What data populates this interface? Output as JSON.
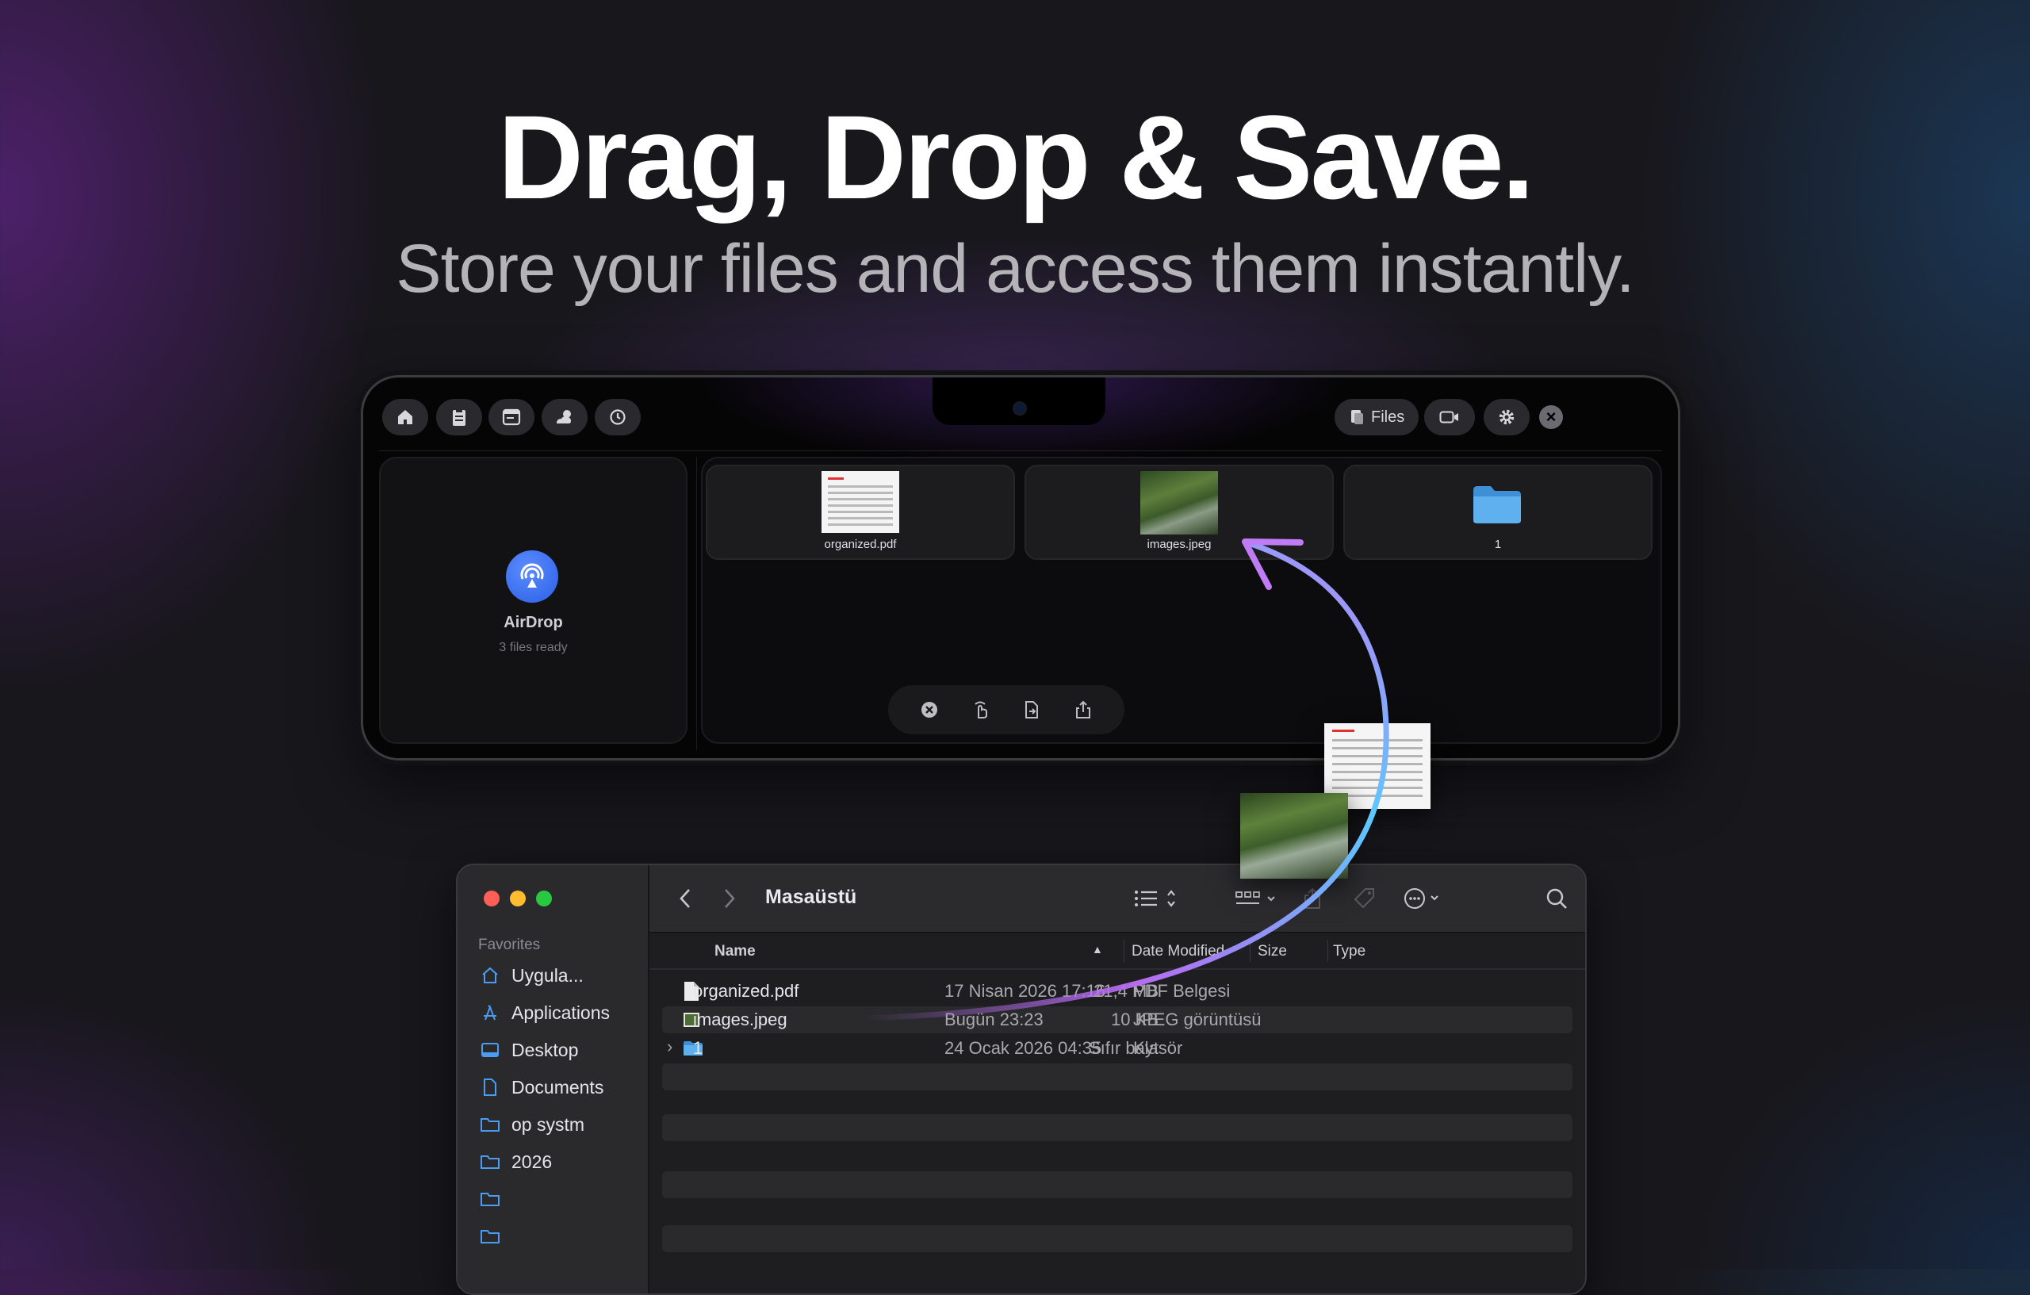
{
  "hero": {
    "title": "Drag, Drop & Save.",
    "subtitle": "Store your files and access them instantly."
  },
  "notch_app": {
    "toolbar_left": [
      "home-icon",
      "clipboard-icon",
      "calendar-icon",
      "weather-icon",
      "timer-icon"
    ],
    "files_button": "Files",
    "toolbar_right": [
      "camera-icon",
      "gear-icon",
      "close-icon"
    ],
    "airdrop": {
      "label": "AirDrop",
      "status": "3 files ready"
    },
    "shelf_files": [
      {
        "name": "organized.pdf",
        "kind": "pdf"
      },
      {
        "name": "images.jpeg",
        "kind": "image"
      },
      {
        "name": "1",
        "kind": "folder"
      }
    ],
    "actions": [
      "clear-icon",
      "drag-icon",
      "convert-icon",
      "share-icon"
    ]
  },
  "finder": {
    "sidebar": {
      "section": "Favorites",
      "items": [
        {
          "label": "Uygula...",
          "icon": "home-icon"
        },
        {
          "label": "Applications",
          "icon": "applications-icon"
        },
        {
          "label": "Desktop",
          "icon": "desktop-icon"
        },
        {
          "label": "Documents",
          "icon": "document-icon"
        },
        {
          "label": "op systm",
          "icon": "folder-icon"
        },
        {
          "label": "2026",
          "icon": "folder-icon"
        },
        {
          "label": "",
          "icon": "folder-icon"
        },
        {
          "label": "",
          "icon": "folder-icon"
        }
      ]
    },
    "toolbar": {
      "title": "Masaüstü"
    },
    "columns": {
      "name": "Name",
      "date": "Date Modified",
      "size": "Size",
      "type": "Type"
    },
    "rows": [
      {
        "name": "organized.pdf",
        "date": "17 Nisan 2026 17:16",
        "size": "21,4 MB",
        "type": "PDF Belgesi"
      },
      {
        "name": "images.jpeg",
        "date": "Bugün 23:23",
        "size": "10 KB",
        "type": "JPEG görüntüsü"
      },
      {
        "name": "1",
        "date": "24 Ocak 2026 04:35",
        "size": "Sıfır bayt",
        "type": "Klasör"
      }
    ]
  },
  "colors": {
    "accent_blue": "#4a9cf5",
    "arrow_start": "#b66cf0",
    "arrow_end": "#5cc8ff",
    "close_red": "#fe5f57",
    "minimize_yellow": "#febc2e",
    "zoom_green": "#28c840"
  }
}
